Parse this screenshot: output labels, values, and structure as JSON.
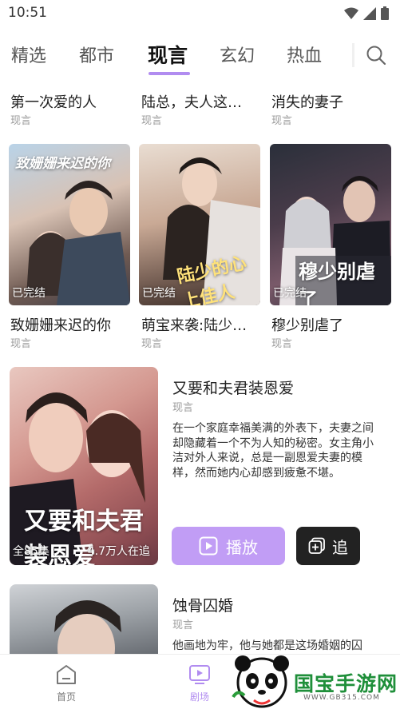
{
  "status_bar": {
    "time": "10:51"
  },
  "tabs": [
    {
      "label": "精选"
    },
    {
      "label": "都市"
    },
    {
      "label": "现言"
    },
    {
      "label": "玄幻"
    },
    {
      "label": "热血"
    }
  ],
  "row1": [
    {
      "title": "第一次爱的人",
      "genre": "现言"
    },
    {
      "title": "陆总，夫人这…",
      "genre": "现言"
    },
    {
      "title": "消失的妻子",
      "genre": "现言"
    }
  ],
  "row2": [
    {
      "title": "致姗姗来迟的你",
      "genre": "现言",
      "status": "已完结",
      "cover_art": "致姗姗来迟的你"
    },
    {
      "title": "萌宝来袭:陆少…",
      "genre": "现言",
      "status": "已完结",
      "cover_art": "陆少的心上佳人"
    },
    {
      "title": "穆少别虐了",
      "genre": "现言",
      "status": "已完结",
      "cover_art": "穆少别虐了"
    }
  ],
  "featured": [
    {
      "title": "又要和夫君装恩爱",
      "genre": "现言",
      "description": "在一个家庭幸福美满的外表下，夫妻之间却隐藏着一个不为人知的秘密。女主角小洁对外人来说，总是一副恩爱夫妻的模样，然而她内心却感到疲惫不堪。",
      "episodes": "全85集",
      "followers": "4.7万人在追",
      "cover_art": "又要和夫君装恩爱",
      "play_label": "播放",
      "follow_label": "追"
    },
    {
      "title": "蚀骨囚婚",
      "genre": "现言",
      "description": "他画地为牢，他与她都是这场婚姻的囚"
    }
  ],
  "bottom_nav": [
    {
      "label": "首页",
      "icon": "home-icon"
    },
    {
      "label": "剧场",
      "icon": "theater-icon"
    }
  ],
  "watermark": {
    "brand": "国宝手游网",
    "url": "WWW.GB315.COM"
  },
  "colors": {
    "accent": "#c19df5",
    "tab_underline": "#b18cf0",
    "dark_button": "#222222"
  }
}
